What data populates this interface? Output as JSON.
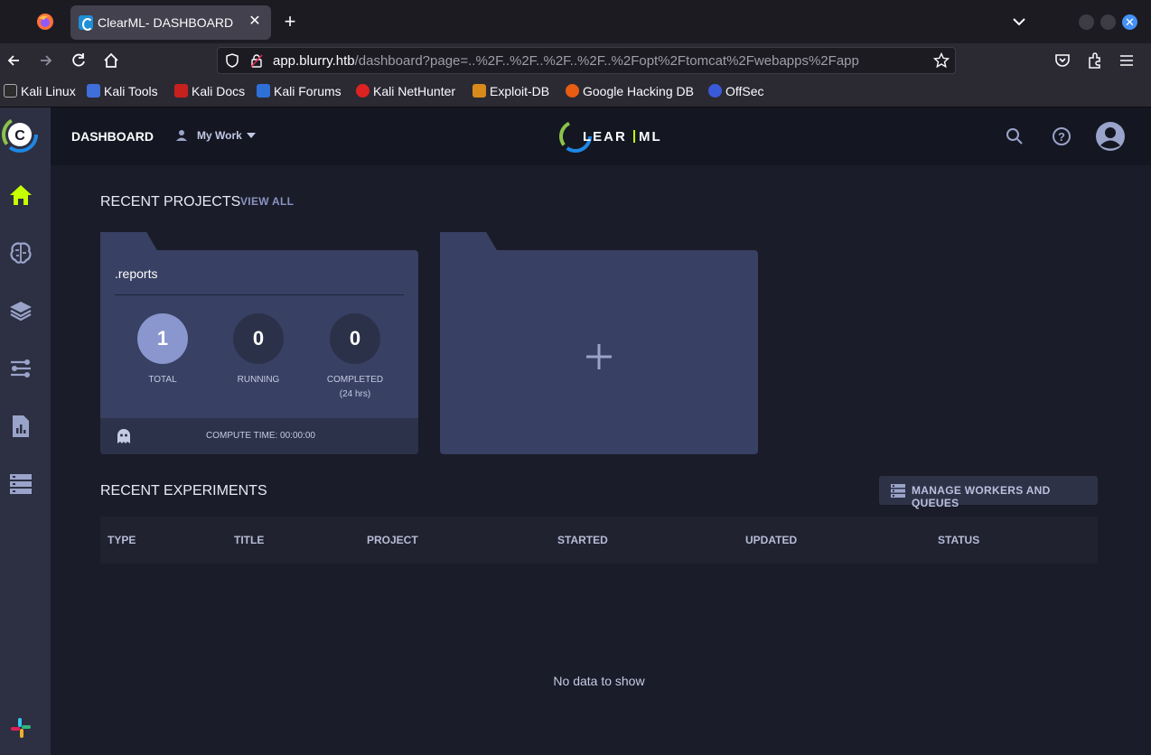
{
  "browser": {
    "tab_title": "ClearML- DASHBOARD",
    "url_domain": "app.blurry.htb",
    "url_prefix": "",
    "url_path": "/dashboard?page=..%2F..%2F..%2F..%2F..%2Fopt%2Ftomcat%2Fwebapps%2Fapp",
    "bookmarks": [
      "Kali Linux",
      "Kali Tools",
      "Kali Docs",
      "Kali Forums",
      "Kali NetHunter",
      "Exploit-DB",
      "Google Hacking DB",
      "OffSec"
    ]
  },
  "header": {
    "breadcrumb": "DASHBOARD",
    "my_work": "My Work"
  },
  "projects": {
    "title": "RECENT PROJECTS",
    "view_all": "VIEW ALL",
    "card": {
      "name": ".reports",
      "total": "1",
      "total_label": "TOTAL",
      "running": "0",
      "running_label": "RUNNING",
      "completed": "0",
      "completed_label": "COMPLETED",
      "completed_sub": "(24 hrs)",
      "compute_time": "COMPUTE TIME: 00:00:00"
    }
  },
  "experiments": {
    "title": "RECENT EXPERIMENTS",
    "manage_button": "MANAGE WORKERS AND QUEUES",
    "columns": [
      "TYPE",
      "TITLE",
      "PROJECT",
      "STARTED",
      "UPDATED",
      "STATUS"
    ],
    "empty_message": "No data to show"
  },
  "colors": {
    "accent_home": "#c6ff00",
    "sidebar_bg": "#2c3042",
    "card_bg": "#384063"
  }
}
